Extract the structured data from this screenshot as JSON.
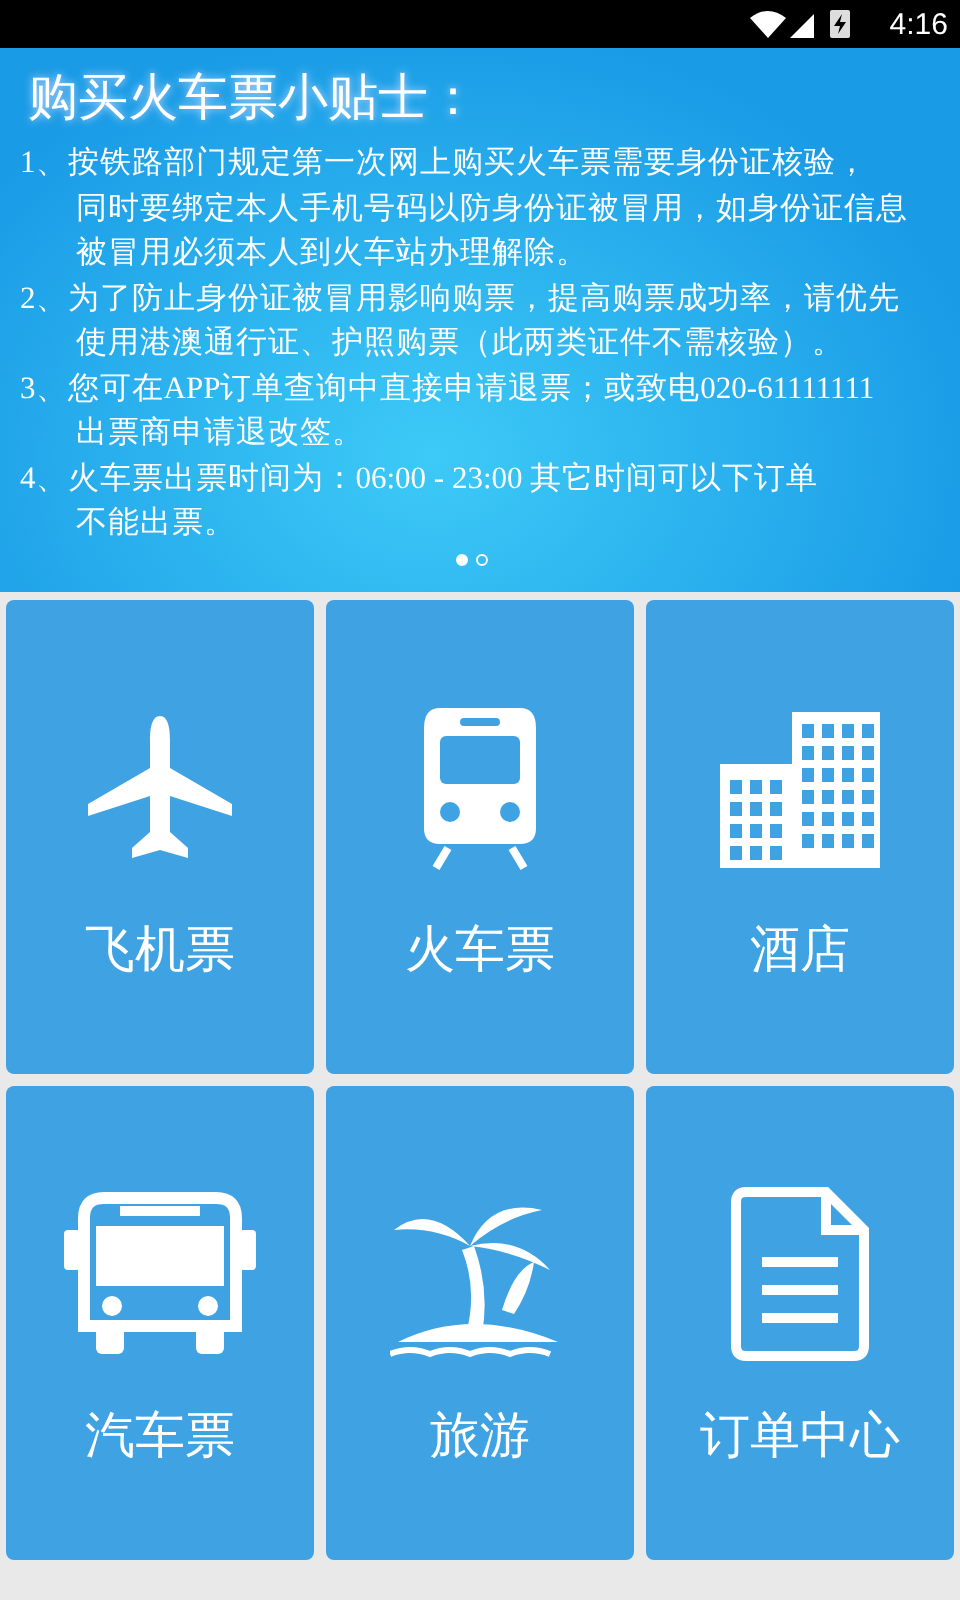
{
  "status_bar": {
    "time": "4:16"
  },
  "banner": {
    "title": "购买火车票小贴士：",
    "tips": [
      {
        "lines": [
          "1、按铁路部门规定第一次网上购买火车票需要身份证核验，",
          "同时要绑定本人手机号码以防身份证被冒用，如身份证信息",
          "被冒用必须本人到火车站办理解除。"
        ]
      },
      {
        "lines": [
          "2、为了防止身份证被冒用影响购票，提高购票成功率，请优先",
          "使用港澳通行证、护照购票（此两类证件不需核验）。"
        ]
      },
      {
        "lines": [
          "3、您可在APP订单查询中直接申请退票；或致电020-61111111",
          "出票商申请退改签。"
        ]
      },
      {
        "lines": [
          "4、火车票出票时间为：06:00 - 23:00 其它时间可以下订单",
          "不能出票。"
        ]
      }
    ],
    "pages": [
      {
        "selected": true
      },
      {
        "selected": false
      }
    ]
  },
  "tiles": [
    {
      "kind": "plane",
      "label": "飞机票"
    },
    {
      "kind": "train",
      "label": "火车票"
    },
    {
      "kind": "hotel",
      "label": "酒店"
    },
    {
      "kind": "bus",
      "label": "汽车票"
    },
    {
      "kind": "island",
      "label": "旅游"
    },
    {
      "kind": "document",
      "label": "订单中心"
    }
  ]
}
